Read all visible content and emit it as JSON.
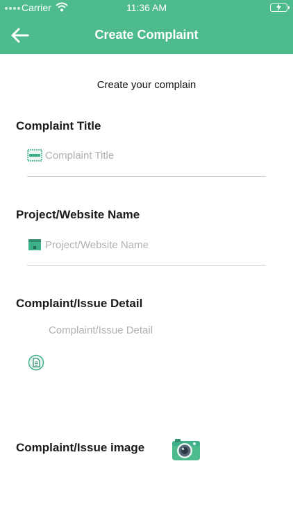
{
  "status_bar": {
    "carrier": "Carrier",
    "time": "11:36 AM"
  },
  "nav": {
    "title": "Create Complaint"
  },
  "subtitle": "Create your complain",
  "fields": {
    "title": {
      "label": "Complaint Title",
      "placeholder": "Complaint Title"
    },
    "project": {
      "label": "Project/Website Name",
      "placeholder": "Project/Website Name"
    },
    "detail": {
      "label": "Complaint/Issue Detail",
      "placeholder": "Complaint/Issue Detail"
    },
    "image": {
      "label": "Complaint/Issue image"
    }
  },
  "colors": {
    "header": "#4dbb8c",
    "accent": "#3fae8b"
  }
}
